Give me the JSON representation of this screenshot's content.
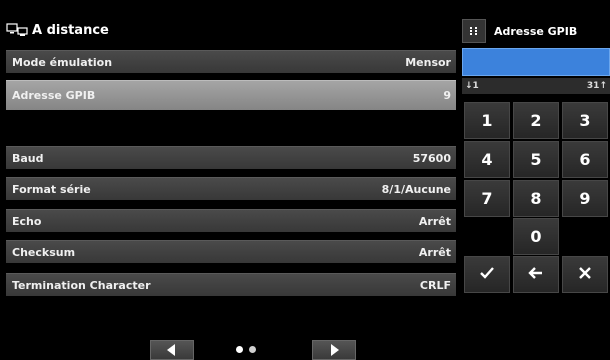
{
  "header": {
    "title": "A distance",
    "icon": "remote-computer-icon"
  },
  "settings": [
    {
      "label": "Mode émulation",
      "value": "Mensor"
    },
    {
      "label": "Adresse GPIB",
      "value": "9"
    },
    {
      "label": "Baud",
      "value": "57600"
    },
    {
      "label": "Format série",
      "value": "8/1/Aucune"
    },
    {
      "label": "Echo",
      "value": "Arrêt"
    },
    {
      "label": "Checksum",
      "value": "Arrêt"
    },
    {
      "label": "Termination Character",
      "value": "CRLF"
    }
  ],
  "keypad": {
    "title": "Adresse GPIB",
    "menu_icon": "grid-menu-icon",
    "entry_value": "",
    "range_min": "↓1",
    "range_max": "31↑",
    "keys": [
      "1",
      "2",
      "3",
      "4",
      "5",
      "6",
      "7",
      "8",
      "9",
      "0"
    ],
    "accept_icon": "checkmark-icon",
    "backspace_icon": "backspace-arrow-icon",
    "cancel_icon": "close-icon"
  },
  "nav": {
    "prev_icon": "left-arrow-icon",
    "next_icon": "right-arrow-icon",
    "page_count": 2,
    "active_page": 1
  },
  "colors": {
    "entry_field": "#3c82dc",
    "selected_row": "#959595",
    "row": "#404040"
  }
}
